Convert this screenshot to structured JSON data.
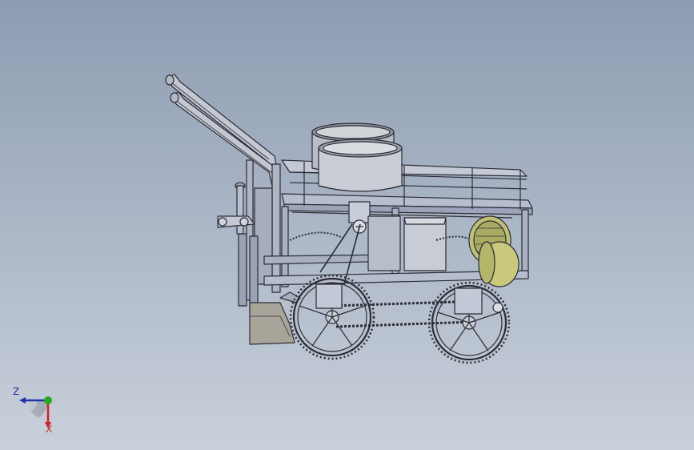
{
  "viewport": {
    "background_top": "#8e9cb2",
    "background_bottom": "#c9d0da"
  },
  "model": {
    "description_icon": "seeder-cart-model",
    "frame_color": "#b6bdcf",
    "edge_color": "#2c2c34",
    "seed_box_color": "#c9ced6",
    "drum_color": "#c8c97a",
    "drum_edge_color": "#6a6c34"
  },
  "triad": {
    "z_label": "Z",
    "x_label": "X",
    "z_color": "#2233aa",
    "x_color": "#cc2222",
    "y_color": "#22aa22"
  }
}
